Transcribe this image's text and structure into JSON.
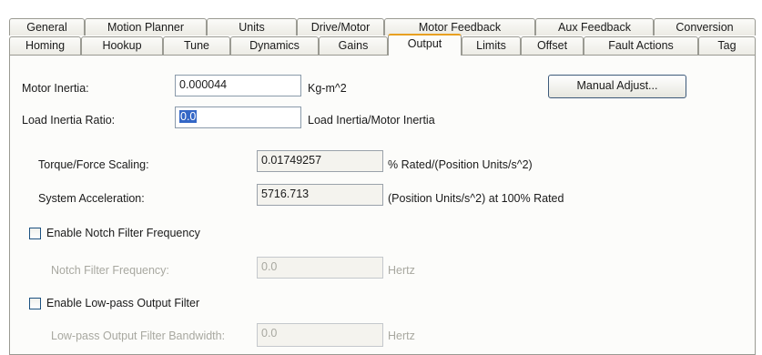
{
  "tabs_row1": [
    "General",
    "Motion Planner",
    "Units",
    "Drive/Motor",
    "Motor Feedback",
    "Aux Feedback",
    "Conversion"
  ],
  "tabs_row2": [
    "Homing",
    "Hookup",
    "Tune",
    "Dynamics",
    "Gains",
    "Output",
    "Limits",
    "Offset",
    "Fault Actions",
    "Tag"
  ],
  "active_tab": "Output",
  "form": {
    "motor_inertia_label": "Motor Inertia:",
    "motor_inertia_value": "0.000044",
    "motor_inertia_unit": "Kg-m^2",
    "manual_adjust_label": "Manual Adjust...",
    "load_inertia_label": "Load Inertia Ratio:",
    "load_inertia_value": "0.0",
    "load_inertia_unit": "Load Inertia/Motor Inertia",
    "torque_label": "Torque/Force Scaling:",
    "torque_value": "0.01749257",
    "torque_unit": "% Rated/(Position Units/s^2)",
    "sys_accel_label": "System Acceleration:",
    "sys_accel_value": "5716.713",
    "sys_accel_unit": "(Position Units/s^2) at 100% Rated",
    "notch_enable_label": "Enable Notch Filter Frequency",
    "notch_enabled": false,
    "notch_freq_label": "Notch Filter Frequency:",
    "notch_freq_value": "0.0",
    "notch_freq_unit": "Hertz",
    "lowpass_enable_label": "Enable Low-pass Output Filter",
    "lowpass_enabled": false,
    "lowpass_bw_label": "Low-pass Output Filter Bandwidth:",
    "lowpass_bw_value": "0.0",
    "lowpass_bw_unit": "Hertz"
  },
  "colors": {
    "active_tab_accent": "#e8a020",
    "selection": "#3467c6",
    "disabled_text": "#a8a8a0"
  }
}
